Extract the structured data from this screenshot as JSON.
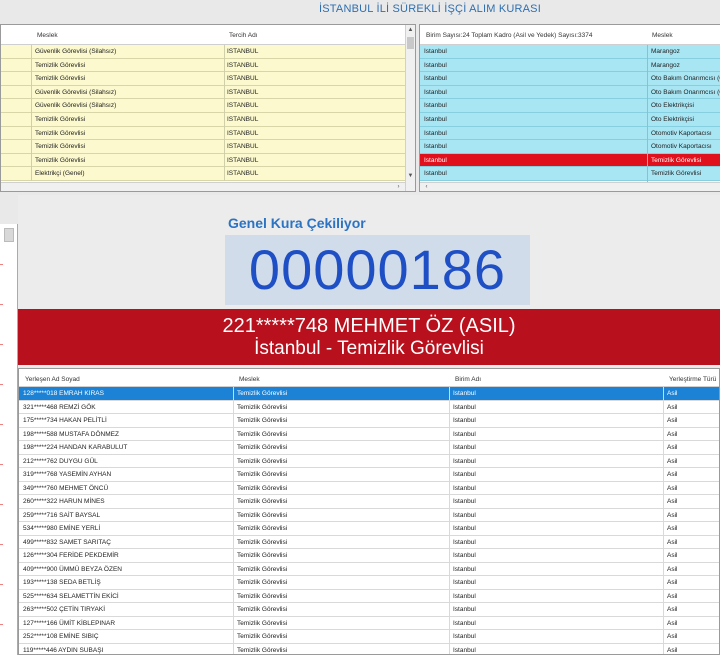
{
  "app_title": "İSTANBUL İLİ SÜREKLİ İŞÇİ ALIM KURASI",
  "left_grid": {
    "columns": [
      "Meslek",
      "Tercih Adı"
    ],
    "rows": [
      [
        "Güvenlik Görevlisi (Silahsız)",
        "ISTANBUL"
      ],
      [
        "Temizlik Görevlisi",
        "ISTANBUL"
      ],
      [
        "Temizlik Görevlisi",
        "ISTANBUL"
      ],
      [
        "Güvenlik Görevlisi (Silahsız)",
        "ISTANBUL"
      ],
      [
        "Güvenlik Görevlisi (Silahsız)",
        "ISTANBUL"
      ],
      [
        "Temizlik Görevlisi",
        "ISTANBUL"
      ],
      [
        "Temizlik Görevlisi",
        "ISTANBUL"
      ],
      [
        "Temizlik Görevlisi",
        "ISTANBUL"
      ],
      [
        "Temizlik Görevlisi",
        "ISTANBUL"
      ],
      [
        "Elektrikçi (Genel)",
        "ISTANBUL"
      ]
    ]
  },
  "right_grid": {
    "columns": [
      "Birim Sayısı:24 Toplam Kadro (Asil ve Yedek) Sayısı:3374",
      "Meslek"
    ],
    "rows": [
      [
        "Istanbul",
        "Marangoz"
      ],
      [
        "Istanbul",
        "Marangoz"
      ],
      [
        "Istanbul",
        "Oto Bakım Onarımcısı (O"
      ],
      [
        "Istanbul",
        "Oto Bakım Onarımcısı (O"
      ],
      [
        "Istanbul",
        "Oto Elektrikçisi"
      ],
      [
        "Istanbul",
        "Oto Elektrikçisi"
      ],
      [
        "Istanbul",
        "Otomotiv Kaportacısı"
      ],
      [
        "Istanbul",
        "Otomotiv Kaportacısı"
      ],
      [
        "Istanbul",
        "Temizlik Görevlisi"
      ],
      [
        "Istanbul",
        "Temizlik Görevlisi"
      ]
    ],
    "selected_row": 8
  },
  "draw": {
    "label": "Genel Kura Çekiliyor",
    "number": "00000186",
    "winner_line1": "221*****748 MEHMET ÖZ (ASIL)",
    "winner_line2": "İstanbul - Temizlik Görevlisi"
  },
  "bottom_grid": {
    "columns": [
      "Yerleşen Ad Soyad",
      "Meslek",
      "Birim Adı",
      "Yerleştirme Türü"
    ],
    "selected_row": 0,
    "rows": [
      [
        "128*****018 EMRAH KIRAS",
        "Temizlik Görevlisi",
        "Istanbul",
        "Asil"
      ],
      [
        "321*****468 REMZİ GÖK",
        "Temizlik Görevlisi",
        "Istanbul",
        "Asil"
      ],
      [
        "175*****734 HAKAN PELİTLİ",
        "Temizlik Görevlisi",
        "Istanbul",
        "Asil"
      ],
      [
        "198*****588 MUSTAFA DÖNMEZ",
        "Temizlik Görevlisi",
        "Istanbul",
        "Asil"
      ],
      [
        "198*****224 HANDAN KARABULUT",
        "Temizlik Görevlisi",
        "Istanbul",
        "Asil"
      ],
      [
        "212*****762 DUYGU GÜL",
        "Temizlik Görevlisi",
        "Istanbul",
        "Asil"
      ],
      [
        "319*****768 YASEMİN AYHAN",
        "Temizlik Görevlisi",
        "Istanbul",
        "Asil"
      ],
      [
        "349*****760 MEHMET ÖNCÜ",
        "Temizlik Görevlisi",
        "Istanbul",
        "Asil"
      ],
      [
        "260*****322 HARUN MİNES",
        "Temizlik Görevlisi",
        "Istanbul",
        "Asil"
      ],
      [
        "259*****716 SAİT BAYSAL",
        "Temizlik Görevlisi",
        "Istanbul",
        "Asil"
      ],
      [
        "534*****980 EMİNE YERLİ",
        "Temizlik Görevlisi",
        "Istanbul",
        "Asil"
      ],
      [
        "499*****832 SAMET SARITAÇ",
        "Temizlik Görevlisi",
        "Istanbul",
        "Asil"
      ],
      [
        "126*****304 FERİDE PEKDEMİR",
        "Temizlik Görevlisi",
        "Istanbul",
        "Asil"
      ],
      [
        "409*****900 ÜMMÜ BEYZA ÖZEN",
        "Temizlik Görevlisi",
        "Istanbul",
        "Asil"
      ],
      [
        "193*****138 SEDA BETLİŞ",
        "Temizlik Görevlisi",
        "Istanbul",
        "Asil"
      ],
      [
        "525*****634 SELAMETTİN EKİCİ",
        "Temizlik Görevlisi",
        "Istanbul",
        "Asil"
      ],
      [
        "263*****502 ÇETİN TIRYAKİ",
        "Temizlik Görevlisi",
        "Istanbul",
        "Asil"
      ],
      [
        "127*****166 ÜMİT KİBLEPINAR",
        "Temizlik Görevlisi",
        "Istanbul",
        "Asil"
      ],
      [
        "252*****108 EMİNE SIBIÇ",
        "Temizlik Görevlisi",
        "Istanbul",
        "Asil"
      ],
      [
        "119*****446 AYDIN SUBAŞI",
        "Temizlik Görevlisi",
        "Istanbul",
        "Asil"
      ]
    ]
  },
  "colors": {
    "left_row_bg": "#fbf9cd",
    "right_row_bg": "#a9e6f4",
    "selected_red": "#e0101c",
    "winner_banner": "#b8101c",
    "selected_blue": "#1b82d6",
    "number_color": "#1e4fc4",
    "title_color": "#2f6fb0"
  }
}
